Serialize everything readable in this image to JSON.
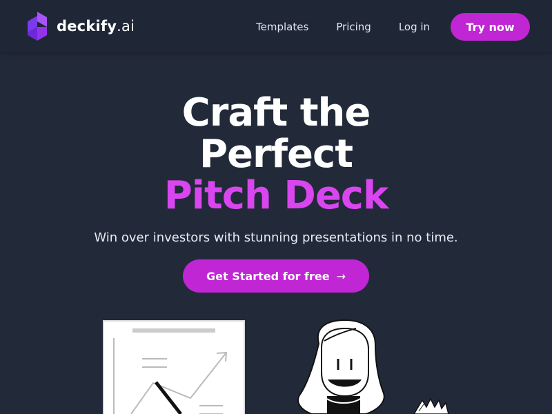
{
  "nav": {
    "logo_main": "deckify",
    "logo_tld": ".ai",
    "links": [
      "Templates",
      "Pricing",
      "Log in"
    ],
    "try_button": "Try now"
  },
  "hero": {
    "title_line1": "Craft the",
    "title_line2": "Perfect",
    "title_line3": "Pitch Deck",
    "subtitle": "Win over investors with stunning presentations in no time.",
    "cta_label": "Get Started for free",
    "cta_icon": "arrow-right-icon"
  },
  "colors": {
    "background": "#222a3a",
    "nav_background": "#1f2636",
    "accent": "#c026d3",
    "accent_text": "#d946ef",
    "logo_purple": "#8b5cf6"
  },
  "illustration": {
    "icons": [
      "growth-chart-card",
      "woman-character",
      "raised-hand"
    ]
  }
}
